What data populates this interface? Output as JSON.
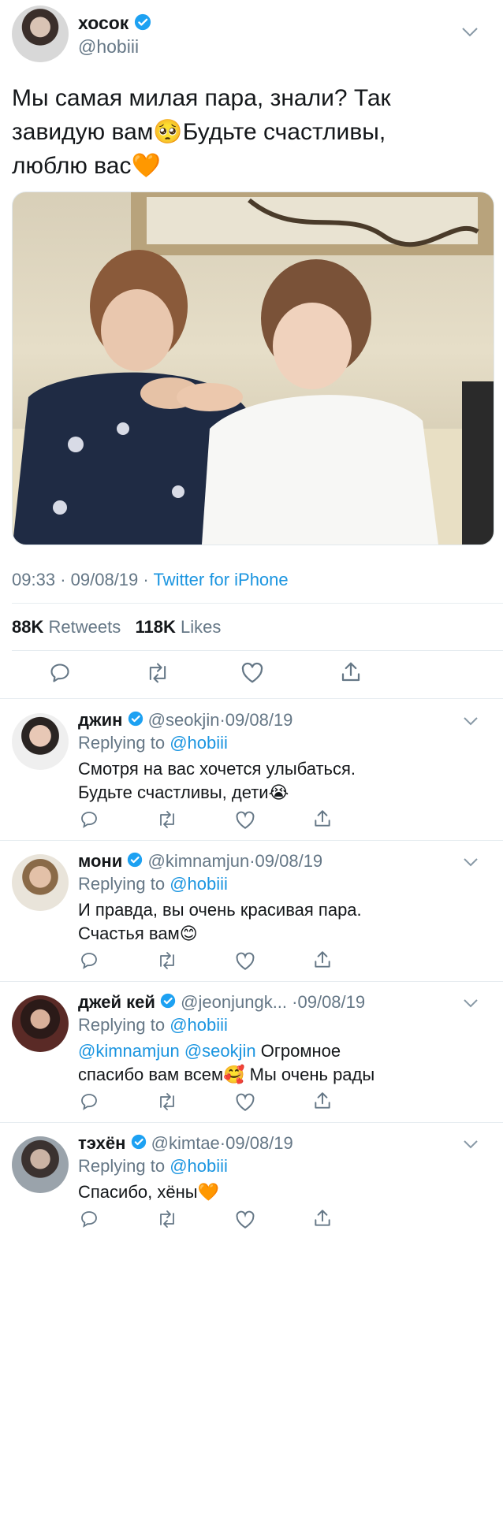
{
  "tweet": {
    "author_name": "хосок",
    "author_handle": "@hobiii",
    "text_line1": "Мы самая милая пара, знали? Так",
    "text_line2": "завидую вам",
    "text_line2b": "Будьте счастливы,",
    "text_line3": "люблю вас",
    "emoji_pleading": "🥺",
    "emoji_heart": "🧡",
    "time": "09:33",
    "date": "09/08/19",
    "source": "Twitter for iPhone",
    "retweets_count": "88K",
    "retweets_label": "Retweets",
    "likes_count": "118K",
    "likes_label": "Likes"
  },
  "replies": [
    {
      "name": "джин",
      "handle": "@seokjin",
      "date": "09/08/19",
      "replying_label": "Replying to",
      "replying_to": "@hobiii",
      "line1": "Смотря на вас хочется улыбаться.",
      "line2": "Будьте счастливы, дети",
      "emoji": "😭"
    },
    {
      "name": "мони",
      "handle": "@kimnamjun",
      "date": "09/08/19",
      "replying_label": "Replying to",
      "replying_to": "@hobiii",
      "line1": "И правда, вы очень красивая пара.",
      "line2": "Счастья вам",
      "emoji": "😊"
    },
    {
      "name": "джей кей",
      "handle": "@jeonjungk...",
      "date": "09/08/19",
      "replying_label": "Replying to",
      "replying_to": "@hobiii",
      "mention1": "@kimnamjun",
      "mention2": "@seokjin",
      "line1": "Огромное",
      "line2": "спасибо вам всем",
      "emoji": "🥰",
      "line2b": "Мы очень рады"
    },
    {
      "name": "тэхён",
      "handle": "@kimtae",
      "date": "09/08/19",
      "replying_label": "Replying to",
      "replying_to": "@hobiii",
      "line1": "Спасибо, хёны",
      "emoji": "🧡"
    }
  ],
  "colors": {
    "link": "#1b95e0",
    "muted": "#657786",
    "verified": "#1da1f2",
    "divider": "#e6ecf0"
  }
}
